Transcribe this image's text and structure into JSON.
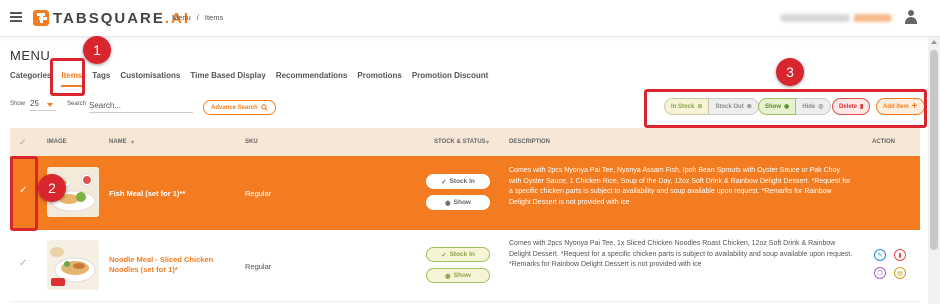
{
  "app": {
    "logo_main": "TABSQUARE",
    "logo_ai": ".AI"
  },
  "breadcrumb": [
    "Menu",
    "/",
    "Items"
  ],
  "page": {
    "title": "MENU"
  },
  "tabs": [
    "Categories",
    "Items",
    "Tags",
    "Customisations",
    "Time Based Display",
    "Recommendations",
    "Promotions",
    "Promotion Discount"
  ],
  "active_tab": "Items",
  "controls": {
    "show_label": "Show",
    "show_value": "25",
    "search_label": "Search",
    "search_placeholder": "Search...",
    "advance_search": "Advance Search",
    "in_stock": "In Stock",
    "stock_out": "Stock Out",
    "show": "Show",
    "hide": "Hide",
    "delete": "Delete",
    "add_item": "Add Item"
  },
  "table": {
    "headers": {
      "image": "IMAGE",
      "name": "NAME",
      "sku": "SKU",
      "stock_status": "STOCK & STATUS",
      "description": "DESCRIPTION",
      "action": "ACTION"
    },
    "rows": [
      {
        "name": "Fish Meal (set for 1)**",
        "sku": "Regular",
        "stock_label": "Stock In",
        "status_label": "Show",
        "description": "Comes with 2pcs Nyonya Pai Tee, Nyonya Assam Fish, Ipoh Bean Sprouts with Oyster Sauce or Pak Choy with Oyster Sauce, 1 Chicken Rice, Soup of the Day, 12oz Soft Drink & Rainbow Delight Dessert. *Request for a specific chicken parts is subject to availability and soup available upon request. *Remarks for Rainbow Delight Dessert is not provided with ice",
        "selected": true
      },
      {
        "name": "Noodle Meal - Sliced Chicken Noodles (set for 1)*",
        "sku": "Regular",
        "stock_label": "Stock In",
        "status_label": "Show",
        "description": "Comes with 2pcs Nyonya Pai Tee, 1x Sliced Chicken Noodles Roast Chicken, 12oz Soft Drink & Rainbow Delight Dessert. *Request for a specific chicken parts is subject to availability and soup available upon request. *Remarks for Rainbow Delight Dessert is not provided with ice",
        "selected": false
      }
    ]
  },
  "annotations": [
    "1",
    "2",
    "3"
  ],
  "colors": {
    "accent": "#f47c20",
    "annotation": "#d9262e",
    "header_bg": "#f6e7d7"
  }
}
